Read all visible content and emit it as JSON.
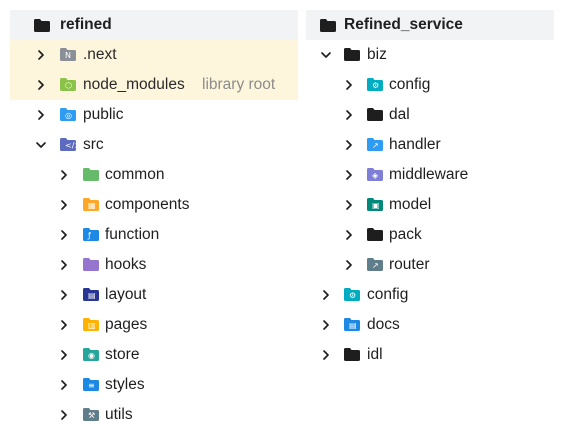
{
  "left_tree": {
    "root": {
      "label": "refined",
      "icon": "folder-icon",
      "color": "#1e1e1e"
    },
    "items": [
      {
        "name": "folder-next",
        "label": ".next",
        "hint": "",
        "depth": 1,
        "expanded": false,
        "excluded": true,
        "icon": "folder-next-icon",
        "color": "#8a8f98",
        "badge": "N",
        "badge_color": "#ffffff"
      },
      {
        "name": "folder-node-modules",
        "label": "node_modules",
        "hint": "library root",
        "depth": 1,
        "expanded": false,
        "excluded": true,
        "icon": "folder-node-modules-icon",
        "color": "#8bc34a",
        "badge": "⬡",
        "badge_color": "#ffffff"
      },
      {
        "name": "folder-public",
        "label": "public",
        "hint": "",
        "depth": 1,
        "expanded": false,
        "excluded": false,
        "icon": "folder-public-icon",
        "color": "#2e9cf3",
        "badge": "◎",
        "badge_color": "#ffffff"
      },
      {
        "name": "folder-src",
        "label": "src",
        "hint": "",
        "depth": 1,
        "expanded": true,
        "excluded": false,
        "icon": "folder-src-icon",
        "color": "#5c6bc0",
        "badge": "</>",
        "badge_color": "#ffffff"
      },
      {
        "name": "folder-common",
        "label": "common",
        "hint": "",
        "depth": 2,
        "expanded": false,
        "excluded": false,
        "icon": "folder-common-icon",
        "color": "#66bb6a",
        "badge": "",
        "badge_color": "#ffffff"
      },
      {
        "name": "folder-components",
        "label": "components",
        "hint": "",
        "depth": 2,
        "expanded": false,
        "excluded": false,
        "icon": "folder-components-icon",
        "color": "#ffa726",
        "badge": "▦",
        "badge_color": "#ffffff"
      },
      {
        "name": "folder-function",
        "label": "function",
        "hint": "",
        "depth": 2,
        "expanded": false,
        "excluded": false,
        "icon": "folder-function-icon",
        "color": "#1e88e5",
        "badge": "ƒ",
        "badge_color": "#ffffff"
      },
      {
        "name": "folder-hooks",
        "label": "hooks",
        "hint": "",
        "depth": 2,
        "expanded": false,
        "excluded": false,
        "icon": "folder-hooks-icon",
        "color": "#9575cd",
        "badge": "",
        "badge_color": "#ffffff"
      },
      {
        "name": "folder-layout",
        "label": "layout",
        "hint": "",
        "depth": 2,
        "expanded": false,
        "excluded": false,
        "icon": "folder-layout-icon",
        "color": "#283593",
        "badge": "▤",
        "badge_color": "#ffffff"
      },
      {
        "name": "folder-pages",
        "label": "pages",
        "hint": "",
        "depth": 2,
        "expanded": false,
        "excluded": false,
        "icon": "folder-pages-icon",
        "color": "#ffb300",
        "badge": "▥",
        "badge_color": "#ffffff"
      },
      {
        "name": "folder-store",
        "label": "store",
        "hint": "",
        "depth": 2,
        "expanded": false,
        "excluded": false,
        "icon": "folder-store-icon",
        "color": "#26a69a",
        "badge": "◉",
        "badge_color": "#ffffff"
      },
      {
        "name": "folder-styles",
        "label": "styles",
        "hint": "",
        "depth": 2,
        "expanded": false,
        "excluded": false,
        "icon": "folder-styles-icon",
        "color": "#1e88e5",
        "badge": "≡",
        "badge_color": "#ffffff"
      },
      {
        "name": "folder-utils",
        "label": "utils",
        "hint": "",
        "depth": 2,
        "expanded": false,
        "excluded": false,
        "icon": "folder-utils-icon",
        "color": "#607d8b",
        "badge": "⚒",
        "badge_color": "#ffffff"
      }
    ]
  },
  "right_tree": {
    "root": {
      "label": "Refined_service",
      "icon": "folder-icon",
      "color": "#1e1e1e"
    },
    "items": [
      {
        "name": "folder-biz",
        "label": "biz",
        "hint": "",
        "depth": 1,
        "expanded": true,
        "excluded": false,
        "icon": "folder-biz-icon",
        "color": "#1e1e1e",
        "badge": "",
        "badge_color": "#ffffff"
      },
      {
        "name": "folder-config",
        "label": "config",
        "hint": "",
        "depth": 2,
        "expanded": false,
        "excluded": false,
        "icon": "folder-config-icon",
        "color": "#00acc1",
        "badge": "⚙",
        "badge_color": "#ffffff"
      },
      {
        "name": "folder-dal",
        "label": "dal",
        "hint": "",
        "depth": 2,
        "expanded": false,
        "excluded": false,
        "icon": "folder-dal-icon",
        "color": "#1e1e1e",
        "badge": "",
        "badge_color": "#ffffff"
      },
      {
        "name": "folder-handler",
        "label": "handler",
        "hint": "",
        "depth": 2,
        "expanded": false,
        "excluded": false,
        "icon": "folder-handler-icon",
        "color": "#2e9cf3",
        "badge": "↗",
        "badge_color": "#ffffff"
      },
      {
        "name": "folder-middleware",
        "label": "middleware",
        "hint": "",
        "depth": 2,
        "expanded": false,
        "excluded": false,
        "icon": "folder-middleware-icon",
        "color": "#7e7fd6",
        "badge": "◈",
        "badge_color": "#ffffff"
      },
      {
        "name": "folder-model",
        "label": "model",
        "hint": "",
        "depth": 2,
        "expanded": false,
        "excluded": false,
        "icon": "folder-model-icon",
        "color": "#00897b",
        "badge": "▣",
        "badge_color": "#ffffff"
      },
      {
        "name": "folder-pack",
        "label": "pack",
        "hint": "",
        "depth": 2,
        "expanded": false,
        "excluded": false,
        "icon": "folder-pack-icon",
        "color": "#1e1e1e",
        "badge": "",
        "badge_color": "#ffffff"
      },
      {
        "name": "folder-router",
        "label": "router",
        "hint": "",
        "depth": 2,
        "expanded": false,
        "excluded": false,
        "icon": "folder-router-icon",
        "color": "#607d8b",
        "badge": "↗",
        "badge_color": "#ffffff"
      },
      {
        "name": "folder-config-root",
        "label": "config",
        "hint": "",
        "depth": 1,
        "expanded": false,
        "excluded": false,
        "icon": "folder-config-icon",
        "color": "#00acc1",
        "badge": "⚙",
        "badge_color": "#ffffff"
      },
      {
        "name": "folder-docs",
        "label": "docs",
        "hint": "",
        "depth": 1,
        "expanded": false,
        "excluded": false,
        "icon": "folder-docs-icon",
        "color": "#1e88e5",
        "badge": "▤",
        "badge_color": "#ffffff"
      },
      {
        "name": "folder-idl",
        "label": "idl",
        "hint": "",
        "depth": 1,
        "expanded": false,
        "excluded": false,
        "icon": "folder-idl-icon",
        "color": "#1e1e1e",
        "badge": "",
        "badge_color": "#ffffff"
      }
    ]
  }
}
